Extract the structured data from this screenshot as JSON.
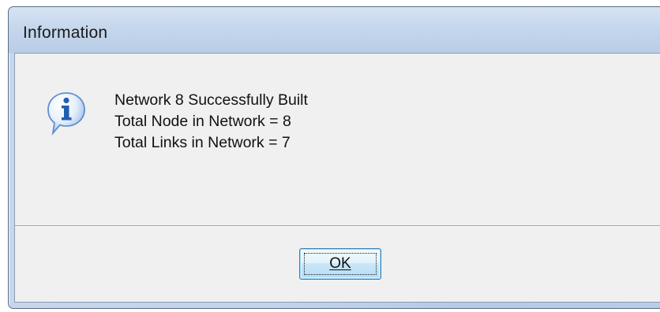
{
  "window": {
    "title": "Information"
  },
  "dialog": {
    "icon": "information-icon",
    "message_lines": [
      "Network 8 Successfully Built",
      "Total Node in Network = 8",
      "Total Links in Network = 7"
    ],
    "ok_label": "OK"
  },
  "colors": {
    "titlebar": "#c4d6ec",
    "client_background": "#f0f0f0",
    "button_border": "#3c7fb1",
    "button_highlight": "#b5dcf5",
    "icon_blue": "#1f5fb0"
  }
}
